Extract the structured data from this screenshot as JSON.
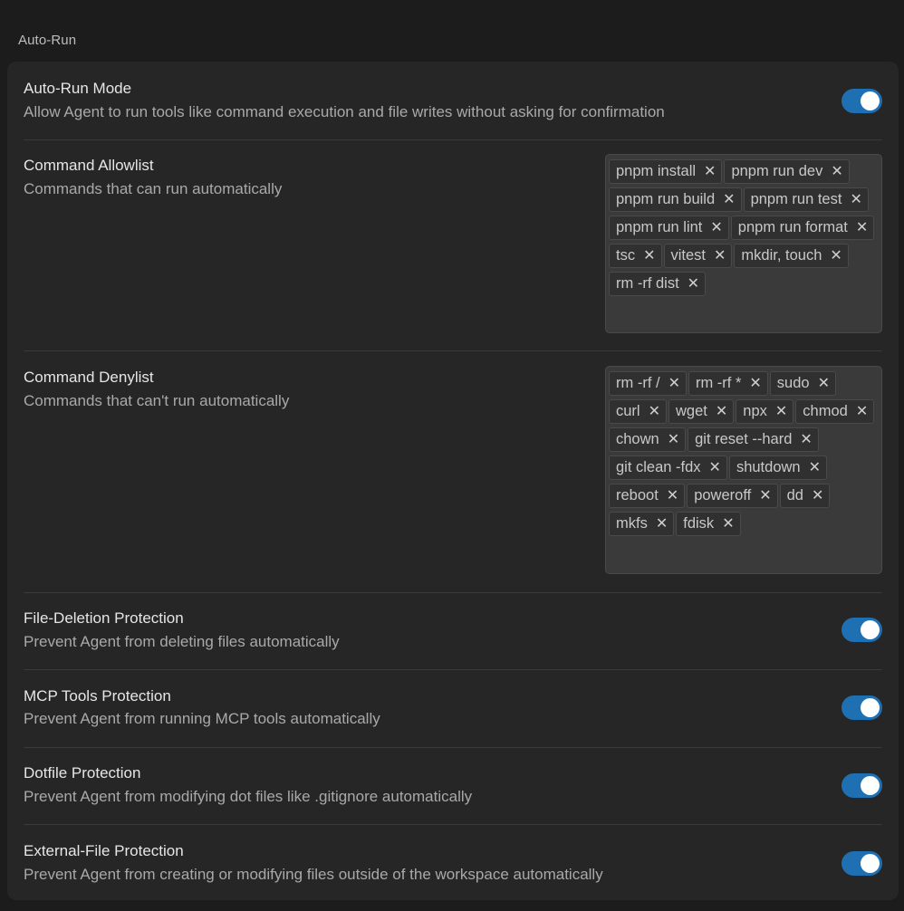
{
  "section_title": "Auto-Run",
  "colors": {
    "toggle_on": "#1f6fb3",
    "card_bg": "#262626",
    "page_bg": "#1c1c1c"
  },
  "auto_run": {
    "title": "Auto-Run Mode",
    "desc": "Allow Agent to run tools like command execution and file writes without asking for confirmation",
    "enabled": true
  },
  "allowlist": {
    "title": "Command Allowlist",
    "desc": "Commands that can run automatically",
    "items": [
      "pnpm install",
      "pnpm run dev",
      "pnpm run build",
      "pnpm run test",
      "pnpm run lint",
      "pnpm run format",
      "tsc",
      "vitest",
      "mkdir, touch",
      "rm -rf dist"
    ]
  },
  "denylist": {
    "title": "Command Denylist",
    "desc": "Commands that can't run automatically",
    "items": [
      "rm -rf /",
      "rm -rf *",
      "sudo",
      "curl",
      "wget",
      "npx",
      "chmod",
      "chown",
      "git reset --hard",
      "git clean -fdx",
      "shutdown",
      "reboot",
      "poweroff",
      "dd",
      "mkfs",
      "fdisk"
    ]
  },
  "file_deletion": {
    "title": "File-Deletion Protection",
    "desc": "Prevent Agent from deleting files automatically",
    "enabled": true
  },
  "mcp_tools": {
    "title": "MCP Tools Protection",
    "desc": "Prevent Agent from running MCP tools automatically",
    "enabled": true
  },
  "dotfile": {
    "title": "Dotfile Protection",
    "desc": "Prevent Agent from modifying dot files like .gitignore automatically",
    "enabled": true
  },
  "external_file": {
    "title": "External-File Protection",
    "desc": "Prevent Agent from creating or modifying files outside of the workspace automatically",
    "enabled": true
  },
  "icons": {
    "remove": "close-icon"
  },
  "remove_glyph": "✕"
}
